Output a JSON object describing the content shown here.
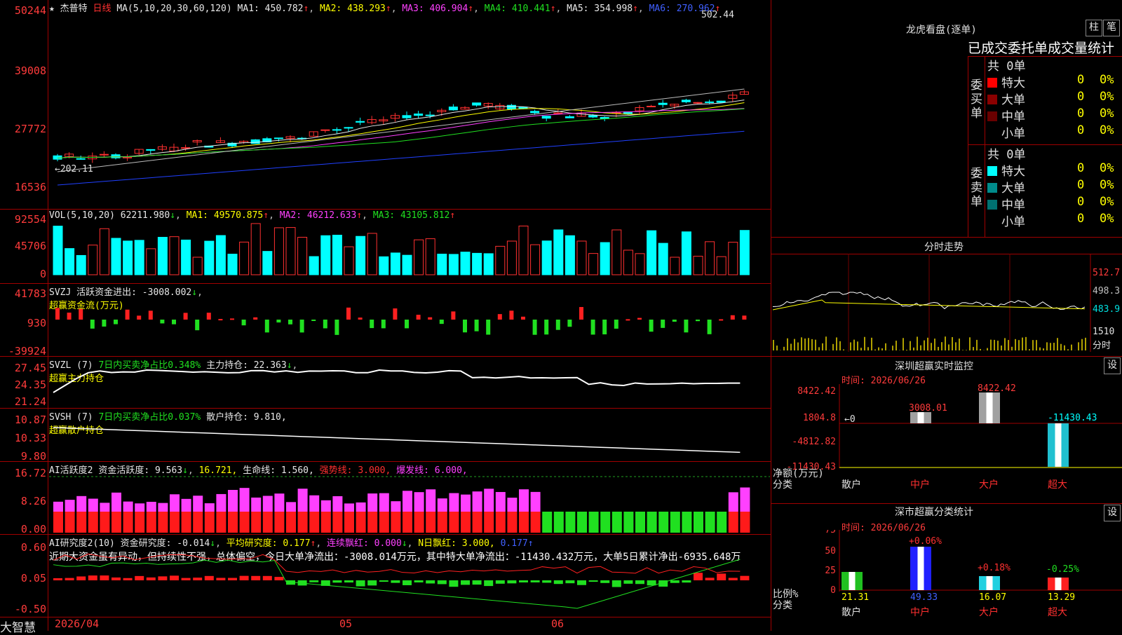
{
  "main": {
    "stock_name": "杰普特",
    "period": "日线",
    "ma_title": "MA(5,10,20,30,60,120)",
    "ma1": "MA1: 450.782",
    "ma2": "MA2: 438.293",
    "ma3": "MA3: 406.904",
    "ma4": "MA4: 410.441",
    "ma5": "MA5: 354.998",
    "ma6": "MA6: 270.962",
    "y_ticks": [
      "50244",
      "39008",
      "27772",
      "16536"
    ],
    "high_label": "502.44",
    "low_label": "202.11"
  },
  "vol": {
    "title": "VOL(5,10,20)",
    "value": "62211.980",
    "ma1": "MA1: 49570.875",
    "ma2": "MA2: 46212.633",
    "ma3": "MA3: 43105.812",
    "y_ticks": [
      "92554",
      "45706",
      "0"
    ]
  },
  "svzj": {
    "title": "SVZJ",
    "desc": "活跃资金进出: -3008.002",
    "sub": "超赢资金流(万元)",
    "y_ticks": [
      "41783",
      "930",
      "-39924"
    ]
  },
  "svzl": {
    "title": "SVZL (7)",
    "desc": "7日内买卖净占比0.348%",
    "hold": "主力持仓: 22.363",
    "sub": "超赢主力持仓",
    "y_ticks": [
      "27.45",
      "24.35",
      "21.24"
    ]
  },
  "svsh": {
    "title": "SVSH (7)",
    "desc": "7日内买卖净占比0.037%",
    "hold": "散户持仓: 9.810,",
    "sub": "超赢散户持仓",
    "y_ticks": [
      "10.87",
      "10.33",
      "9.80"
    ]
  },
  "ai1": {
    "title": "AI活跃度2",
    "desc": "资金活跃度: 9.563",
    "v2": "16.721,",
    "v3": "生命线: 1.560,",
    "v4": "强势线: 3.000,",
    "v5": "爆发线: 6.000,",
    "y_ticks": [
      "16.72",
      "8.26",
      "0.00"
    ]
  },
  "ai2": {
    "title": "AI研究度2(10)",
    "desc": "资金研究度: -0.014",
    "v2": "平均研究度: 0.177",
    "v3": "连续飘红: 0.000",
    "v4": "N日飘红: 3.000,",
    "v5": "0.177",
    "comment": "近期大资金虽有异动，但持续性不强，总体偏空，今日大单净流出：-3008.014万元，其中特大单净流出：-11430.432万元，大单5日累计净出-6935.648万",
    "y_ticks": [
      "0.60",
      "0.05",
      "-0.50"
    ]
  },
  "bottom": {
    "brand": "大智慧",
    "dates": [
      "2026/04",
      "05",
      "06"
    ]
  },
  "right": {
    "lhb_title": "龙虎看盘(逐单)",
    "btn_bar": "柱",
    "btn_note": "笔",
    "tabs_text": "已成交委托单成交量统计",
    "buy_label": "委买单",
    "sell_label": "委卖单",
    "buy_total": "共 0单",
    "sell_total": "共 0单",
    "rows": [
      {
        "name": "特大",
        "count": "0",
        "pct": "0%",
        "color": "#ff0000"
      },
      {
        "name": "大单",
        "count": "0",
        "pct": "0%",
        "color": "#8b0000"
      },
      {
        "name": "中单",
        "count": "0",
        "pct": "0%",
        "color": "#6a0000"
      },
      {
        "name": "小单",
        "count": "0",
        "pct": "0%",
        "color": ""
      }
    ],
    "sell_rows": [
      {
        "name": "特大",
        "count": "0",
        "pct": "0%",
        "color": "#00ffff"
      },
      {
        "name": "大单",
        "count": "0",
        "pct": "0%",
        "color": "#008b8b"
      },
      {
        "name": "中单",
        "count": "0",
        "pct": "0%",
        "color": "#007070"
      },
      {
        "name": "小单",
        "count": "0",
        "pct": "0%",
        "color": ""
      }
    ],
    "minute_title": "分时走势",
    "minute_ticks": [
      "512.7",
      "498.3",
      "483.9",
      "1510",
      "分时"
    ],
    "monitor_title": "深圳超赢实时监控",
    "set_btn": "设",
    "monitor_date": "时间: 2026/06/26",
    "monitor_ticks": [
      "8422.42",
      "1804.8",
      "-4812.82",
      "-11430.43"
    ],
    "monitor_axis_label": "净额(万元)",
    "monitor_cat_label": "分类",
    "monitor_zero": "0",
    "monitor_vals": [
      "3008.01",
      "8422.42",
      "-11430.43"
    ],
    "classify_title": "深市超赢分类统计",
    "classify_date": "时间: 2026/06/26",
    "classify_ticks": [
      "75",
      "50",
      "25",
      "0"
    ],
    "classify_axis_label": "比例%",
    "classify_cat_label": "分类",
    "classify_pct": [
      "+0.06%",
      "+0.18%",
      "-0.25%"
    ],
    "classify_vals": [
      "21.31",
      "49.33",
      "16.07",
      "13.29"
    ],
    "categories": [
      "散户",
      "中户",
      "大户",
      "超大"
    ]
  }
}
